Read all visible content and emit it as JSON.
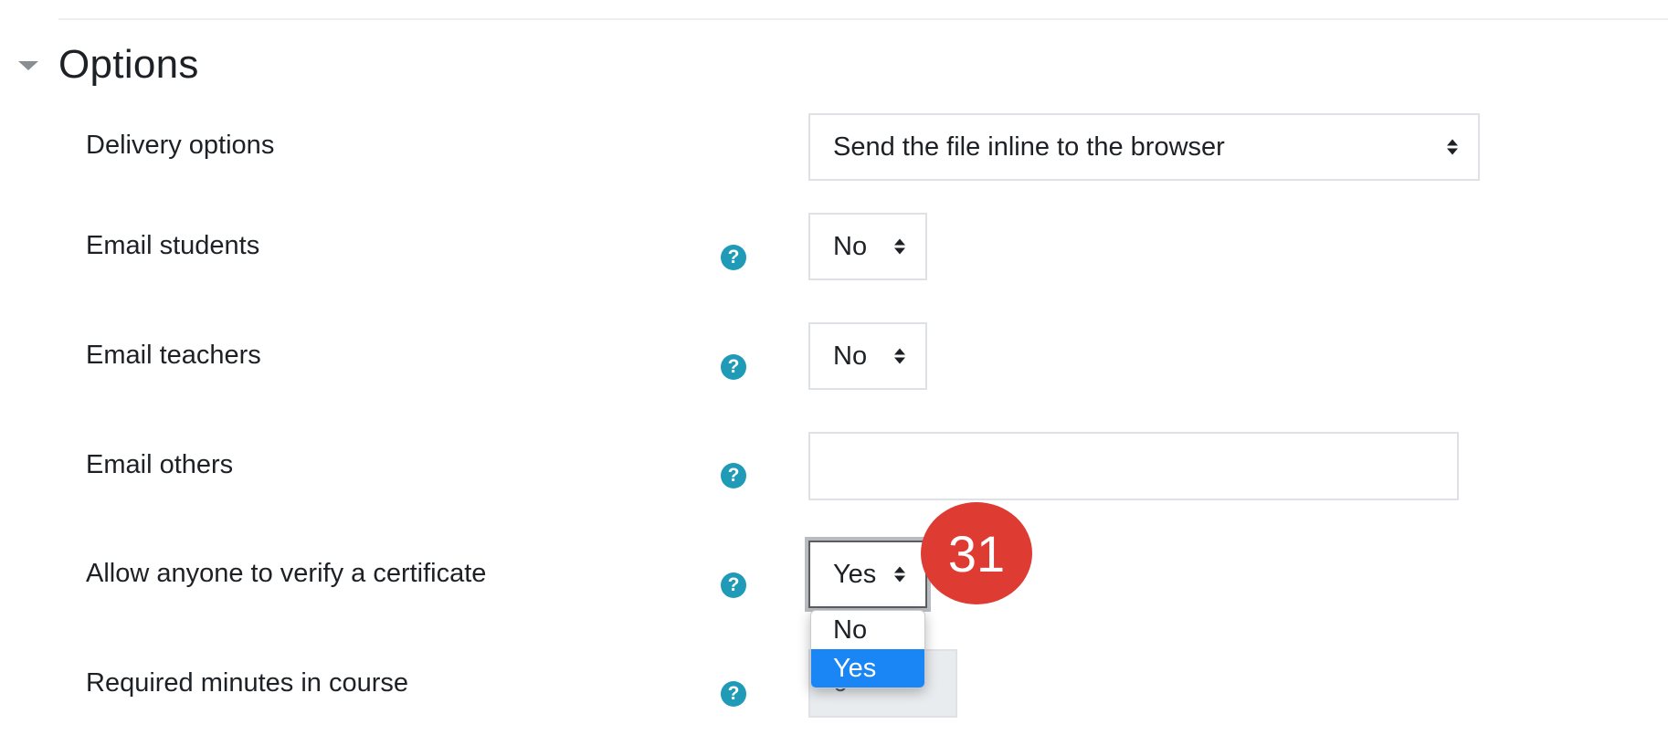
{
  "section": {
    "title": "Options",
    "expanded": true
  },
  "fields": {
    "delivery_options": {
      "label": "Delivery options",
      "value": "Send the file inline to the browser"
    },
    "email_students": {
      "label": "Email students",
      "value": "No"
    },
    "email_teachers": {
      "label": "Email teachers",
      "value": "No"
    },
    "email_others": {
      "label": "Email others",
      "value": ""
    },
    "verify_any": {
      "label": "Allow anyone to verify a certificate",
      "value": "Yes",
      "options": [
        "No",
        "Yes"
      ],
      "selected_option": "Yes"
    },
    "required_minutes": {
      "label": "Required minutes in course",
      "value": "0"
    }
  },
  "help_icon_glyph": "?",
  "step_badge": "31",
  "colors": {
    "help_icon": "#1f9bb8",
    "badge": "#de3b32",
    "selected_option": "#1a85f5"
  },
  "icons": {
    "section_toggle": "caret-down-icon",
    "help": "question-circle-icon",
    "select_arrows": "sort-arrows-icon"
  }
}
